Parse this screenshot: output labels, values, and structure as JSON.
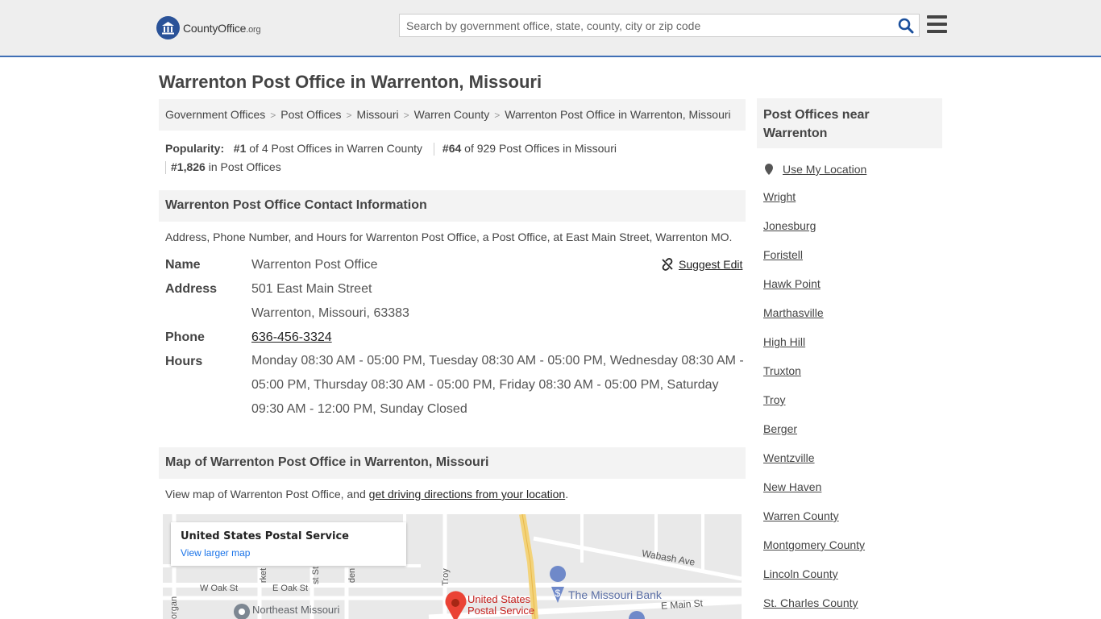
{
  "header": {
    "logo_main": "CountyOffice",
    "logo_suffix": ".org",
    "search_placeholder": "Search by government office, state, county, city or zip code"
  },
  "page_title": "Warrenton Post Office in Warrenton, Missouri",
  "breadcrumb": [
    "Government Offices",
    "Post Offices",
    "Missouri",
    "Warren County",
    "Warrenton Post Office in Warrenton, Missouri"
  ],
  "popularity": {
    "label": "Popularity:",
    "rank1": "#1",
    "rank1_text": "of 4 Post Offices in Warren County",
    "rank2": "#64",
    "rank2_text": "of 929 Post Offices in Missouri",
    "rank3": "#1,826",
    "rank3_text": "in Post Offices"
  },
  "contact": {
    "heading": "Warrenton Post Office Contact Information",
    "description": "Address, Phone Number, and Hours for Warrenton Post Office, a Post Office, at East Main Street, Warrenton MO.",
    "suggest_edit": "Suggest Edit",
    "name_label": "Name",
    "name": "Warrenton Post Office",
    "address_label": "Address",
    "address_line1": "501 East Main Street",
    "address_line2": "Warrenton, Missouri, 63383",
    "phone_label": "Phone",
    "phone": "636-456-3324",
    "hours_label": "Hours",
    "hours": "Monday 08:30 AM - 05:00 PM, Tuesday 08:30 AM - 05:00 PM, Wednesday 08:30 AM - 05:00 PM, Thursday 08:30 AM - 05:00 PM, Friday 08:30 AM - 05:00 PM, Saturday 09:30 AM - 12:00 PM, Sunday Closed"
  },
  "map": {
    "heading": "Map of Warrenton Post Office in Warrenton, Missouri",
    "desc_prefix": "View map of Warrenton Post Office, and ",
    "desc_link": "get driving directions from your location",
    "desc_suffix": ".",
    "card_title": "United States Postal Service",
    "card_link": "View larger map",
    "labels": {
      "wabash": "Wabash Ave",
      "woak": "W Oak St",
      "eoak": "E Oak St",
      "emain": "E Main St",
      "bank": "The Missouri Bank",
      "usps1": "United States",
      "usps2": "Postal Service",
      "nemo": "Northeast Missouri",
      "troy": "Troy",
      "market": "rket",
      "stst": "st St",
      "den": "den",
      "organ": "organ"
    }
  },
  "sidebar": {
    "heading": "Post Offices near Warrenton",
    "use_location": "Use My Location",
    "items": [
      "Wright",
      "Jonesburg",
      "Foristell",
      "Hawk Point",
      "Marthasville",
      "High Hill",
      "Truxton",
      "Troy",
      "Berger",
      "Wentzville",
      "New Haven",
      "Warren County",
      "Montgomery County",
      "Lincoln County",
      "St. Charles County"
    ]
  }
}
